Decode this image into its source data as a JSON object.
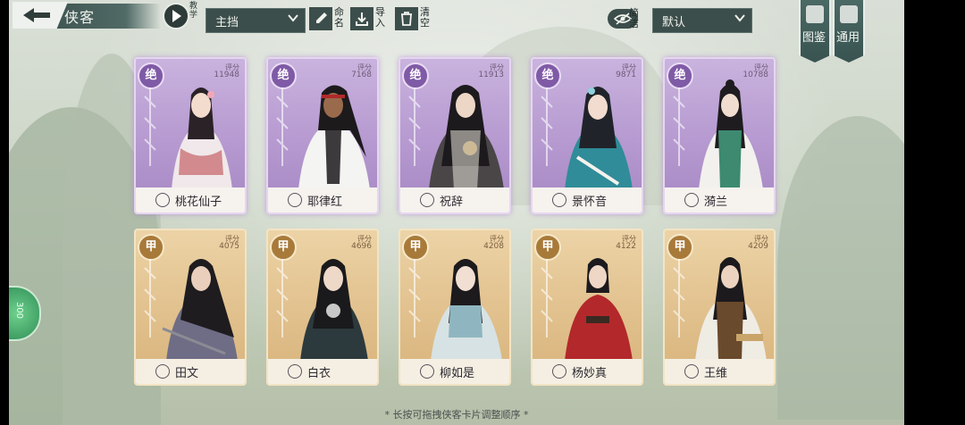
{
  "header": {
    "title": "侠客",
    "teach_label": "教学",
    "team_select": "主挡",
    "rename_label": "命名",
    "import_label": "导入",
    "clear_label": "清空",
    "simple_label": "简洁",
    "sort_select": "默认"
  },
  "side_tabs": {
    "atlas_label": "图鉴",
    "general_label": "通用"
  },
  "score_label": "评分",
  "cards_top": [
    {
      "grade": "绝",
      "score": "11948",
      "name": "桃花仙子"
    },
    {
      "grade": "绝",
      "score": "7168",
      "name": "耶律红"
    },
    {
      "grade": "绝",
      "score": "11913",
      "name": "祝辞"
    },
    {
      "grade": "绝",
      "score": "9871",
      "name": "景怀音"
    },
    {
      "grade": "绝",
      "score": "10788",
      "name": "漪兰"
    }
  ],
  "cards_bottom": [
    {
      "grade": "甲",
      "score": "4075",
      "name": "田文"
    },
    {
      "grade": "甲",
      "score": "4696",
      "name": "白衣"
    },
    {
      "grade": "甲",
      "score": "4208",
      "name": "柳如是"
    },
    {
      "grade": "甲",
      "score": "4122",
      "name": "杨妙真"
    },
    {
      "grade": "甲",
      "score": "4209",
      "name": "王维"
    }
  ],
  "badge_text": "300",
  "hint": "* 长按可拖拽侠客卡片调整顺序 *"
}
